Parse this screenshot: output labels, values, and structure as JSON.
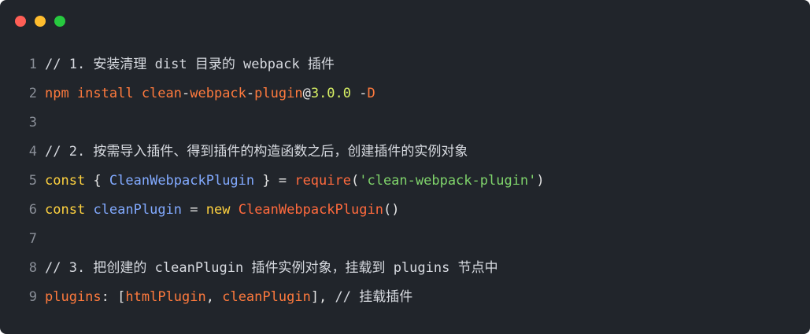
{
  "window": {
    "buttons": {
      "close_color": "#ff5f56",
      "minimize_color": "#ffbd2e",
      "maximize_color": "#27c93f"
    }
  },
  "code": {
    "lines": [
      {
        "number": "1",
        "tokens": [
          {
            "text": "// 1. 安装清理 dist 目录的 webpack 插件",
            "kind": "comment"
          }
        ]
      },
      {
        "number": "2",
        "tokens": [
          {
            "text": "npm install clean",
            "kind": "cmd"
          },
          {
            "text": "-",
            "kind": "plain"
          },
          {
            "text": "webpack",
            "kind": "cmd"
          },
          {
            "text": "-",
            "kind": "plain"
          },
          {
            "text": "plugin",
            "kind": "cmd"
          },
          {
            "text": "@",
            "kind": "plain"
          },
          {
            "text": "3.0.0",
            "kind": "num"
          },
          {
            "text": " -",
            "kind": "plain"
          },
          {
            "text": "D",
            "kind": "cmd"
          }
        ]
      },
      {
        "number": "3",
        "tokens": []
      },
      {
        "number": "4",
        "tokens": [
          {
            "text": "// 2. 按需导入插件、得到插件的构造函数之后，创建插件的实例对象",
            "kind": "comment"
          }
        ]
      },
      {
        "number": "5",
        "tokens": [
          {
            "text": "const",
            "kind": "kw"
          },
          {
            "text": " { ",
            "kind": "op"
          },
          {
            "text": "CleanWebpackPlugin",
            "kind": "var"
          },
          {
            "text": " } = ",
            "kind": "op"
          },
          {
            "text": "require",
            "kind": "fn"
          },
          {
            "text": "(",
            "kind": "op"
          },
          {
            "text": "'clean-webpack-plugin'",
            "kind": "str"
          },
          {
            "text": ")",
            "kind": "op"
          }
        ]
      },
      {
        "number": "6",
        "tokens": [
          {
            "text": "const",
            "kind": "kw"
          },
          {
            "text": " ",
            "kind": "op"
          },
          {
            "text": "cleanPlugin",
            "kind": "var"
          },
          {
            "text": " = ",
            "kind": "op"
          },
          {
            "text": "new",
            "kind": "kw"
          },
          {
            "text": " ",
            "kind": "op"
          },
          {
            "text": "CleanWebpackPlugin",
            "kind": "cls"
          },
          {
            "text": "()",
            "kind": "op"
          }
        ]
      },
      {
        "number": "7",
        "tokens": []
      },
      {
        "number": "8",
        "tokens": [
          {
            "text": "// 3. 把创建的 cleanPlugin 插件实例对象，挂载到 plugins 节点中",
            "kind": "comment"
          }
        ]
      },
      {
        "number": "9",
        "tokens": [
          {
            "text": "plugins",
            "kind": "cmd"
          },
          {
            "text": ": [",
            "kind": "op"
          },
          {
            "text": "htmlPlugin",
            "kind": "cmd"
          },
          {
            "text": ", ",
            "kind": "op"
          },
          {
            "text": "cleanPlugin",
            "kind": "cmd"
          },
          {
            "text": "], ",
            "kind": "op"
          },
          {
            "text": "// 挂载插件",
            "kind": "comment"
          }
        ]
      }
    ]
  }
}
